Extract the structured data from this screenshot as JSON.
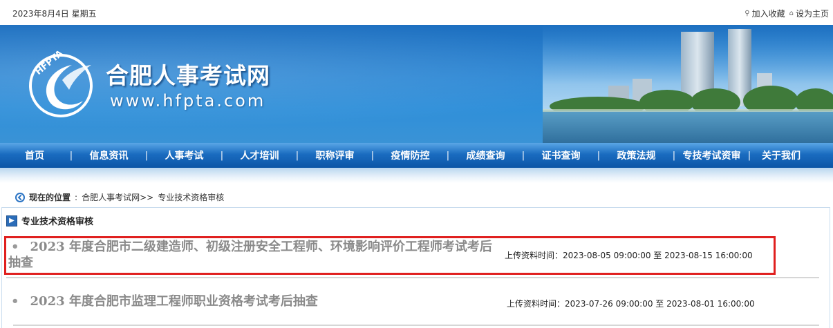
{
  "topbar": {
    "date": "2023年8月4日 星期五",
    "add_favorite": "加入收藏",
    "set_homepage": "设为主页"
  },
  "banner": {
    "logo_text": "HFPTA",
    "site_title": "合肥人事考试网",
    "site_url": "www.hfpta.com"
  },
  "nav": {
    "items": [
      {
        "label": "首页"
      },
      {
        "label": "信息资讯"
      },
      {
        "label": "人事考试"
      },
      {
        "label": "人才培训"
      },
      {
        "label": "职称评审"
      },
      {
        "label": "疫情防控"
      },
      {
        "label": "成绩查询"
      },
      {
        "label": "证书查询"
      },
      {
        "label": "政策法规"
      },
      {
        "label": "专技考试资审"
      },
      {
        "label": "关于我们"
      }
    ]
  },
  "breadcrumb": {
    "prefix": "现在的位置",
    "home": "合肥人事考试网>>",
    "current": "专业技术资格审核"
  },
  "section": {
    "title": "专业技术资格审核"
  },
  "list": [
    {
      "title": "2023 年度合肥市二级建造师、初级注册安全工程师、环境影响评价工程师考试考后抽查",
      "time_label": "上传资料时间：",
      "start": "2023-08-05 09:00:00",
      "to": "至",
      "end": "2023-08-15 16:00:00",
      "highlighted": true
    },
    {
      "title": "2023 年度合肥市监理工程师职业资格考试考后抽查",
      "time_label": "上传资料时间：",
      "start": "2023-07-26 09:00:00",
      "to": "至",
      "end": "2023-08-01 16:00:00",
      "highlighted": false
    }
  ],
  "colors": {
    "nav_bg": "#0c55a6",
    "highlight_border": "#e0201f",
    "title_gray": "#8a8a8a"
  }
}
